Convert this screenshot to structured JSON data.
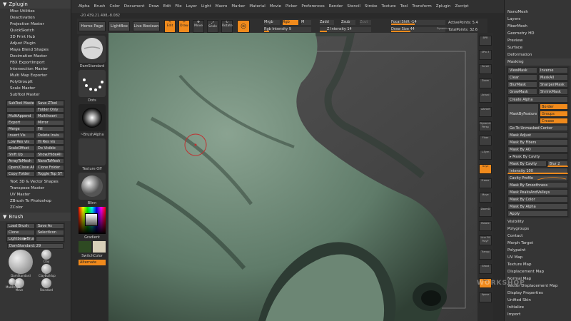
{
  "app": {
    "menu": [
      "Alpha",
      "Brush",
      "Color",
      "Document",
      "Draw",
      "Edit",
      "File",
      "Layer",
      "Light",
      "Macro",
      "Marker",
      "Material",
      "Movie",
      "Picker",
      "Preferences",
      "Render",
      "Stencil",
      "Stroke",
      "Texture",
      "Tool",
      "Transform",
      "Zplugin",
      "Zscript"
    ],
    "coords": "-20.439,21.498,-8.082"
  },
  "left_panel": {
    "title": "Zplugin",
    "items": [
      "Misc Utilities",
      "Deactivation",
      "Projection Master",
      "QuickSketch",
      "3D Print Hub",
      "Adjust Plugin",
      "Maya Blend Shapes",
      "Decimation Master",
      "FBX ExportImport",
      "Intersection Master",
      "Multi Map Exporter",
      "PolyGroupIt",
      "Scale Master"
    ],
    "subtool_title": "SubTool Master",
    "subtool_buttons": [
      "SubTool Master",
      "Save ZTool",
      "",
      "Folder Only",
      "MultiAppend",
      "MultiInsert",
      "Export",
      "Mirror",
      "Merge",
      "Fill",
      "Invert Vis",
      "Delete Invis",
      "Low Res vis",
      "Hi Res vis",
      "ScaleOffset",
      "Do Visible",
      "Shift Up",
      "Show/HideAll",
      "ArrayToMesh",
      "NanoToMesh",
      "Open/Close All",
      "Clone Folder",
      "Copy Folder",
      "Toggle Top ST"
    ],
    "items2": [
      "Text 3D & Vector Shapes",
      "Transpose Master",
      "UV Master",
      "ZBrush To Photoshop",
      "ZColor"
    ],
    "brush_title": "Brush",
    "brush_buttons": [
      "Load Brush",
      "Save As",
      "Clone",
      "SelectIcon",
      "Lightbox▶Brushes",
      ""
    ],
    "brush_slider": "DamStandard: 29",
    "brush_thumbs": [
      "DamStandard",
      "Clay",
      "ClayBuildup",
      "Move",
      "Standard",
      "MaHPolish"
    ]
  },
  "brush_col": {
    "brush": "DamStandard",
    "stroke": "Dots",
    "alpha": "~BrushAlpha",
    "texture": "Texture Off",
    "material": "Blinn",
    "gradient": "Gradient",
    "switch": "SwitchColor",
    "alternate": "Alternate"
  },
  "toolbar": {
    "home": "Home Page",
    "lightbox": "LightBox",
    "live": "Live Boolean",
    "tools": [
      "Edit",
      "Draw",
      "Move",
      "Scale",
      "Rotate"
    ],
    "mrgb": "Mrgb",
    "rgb": "Rgb",
    "m": "M",
    "zadd": "Zadd",
    "zsub": "Zsub",
    "zcut": "Zcut",
    "rgb_intensity": "Rgb Intensity 9",
    "z_intensity": "Z Intensity 14",
    "focal_shift": "Focal Shift -14",
    "draw_size": "Draw Size 44",
    "dynamic": "Dynamic",
    "active_points": "ActivePoints: 5.4",
    "total_points": "TotalPoints: 32.6"
  },
  "shelf": [
    "BPR",
    "SPix 3",
    "Scroll",
    "Zoom",
    "Actual",
    "AAHalf",
    "Dynamic Persp",
    "Floor",
    "L.Sym",
    "Gxyz",
    "Frame",
    "Move",
    "ZoomD",
    "Rotate",
    "Line Fill PolyF",
    "Transp",
    "Ghost",
    "Solo",
    "Xpose"
  ],
  "right_panel": {
    "top_items": [
      "Layers",
      "FiberMesh",
      "Geometry HD",
      "Preview",
      "Surface",
      "Deformation"
    ],
    "nanomesh": "NanoMesh",
    "masking_title": "Masking",
    "mask_rows": [
      [
        "ViewMask",
        "Inverse"
      ],
      [
        "Clear",
        "MaskAll"
      ],
      [
        "BlurMask",
        "SharpenMask"
      ],
      [
        "GrowMask",
        "ShrinkMask"
      ]
    ],
    "create_alpha": "Create Alpha",
    "mask_by_feature": "MaskByFeature",
    "border": "Border",
    "groups": "Groups",
    "crease": "Crease",
    "goto_unmasked": "Go To Unmasked Center",
    "mask_adjust": "Mask Adjust",
    "mask_fibers": "Mask By Fibers",
    "mask_ao": "Mask By AO",
    "mask_cavity": "Mask By Cavity",
    "mask_cavity_btn": "Mask By Cavity",
    "blur": "Blur 2",
    "intensity": "Intensity 100",
    "cavity_profile": "Cavity Profile",
    "mask_items": [
      "Mask By Smoothness",
      "Mask PeaksAndValleys",
      "Mask By Color",
      "Mask By Alpha",
      "Apply"
    ],
    "bottom_items": [
      "Visibility",
      "Polygroups",
      "Contact",
      "Morph Target",
      "Polypaint",
      "UV Map",
      "Texture Map",
      "Displacement Map",
      "Normal Map",
      "Vector Displacement Map",
      "Display Properties",
      "Unified Skin",
      "Initialize",
      "Import"
    ]
  },
  "watermark": "WORKSHOP",
  "colors": {
    "accent": "#f08a1c",
    "panel": "#353535",
    "skin": "#6f8a78"
  }
}
